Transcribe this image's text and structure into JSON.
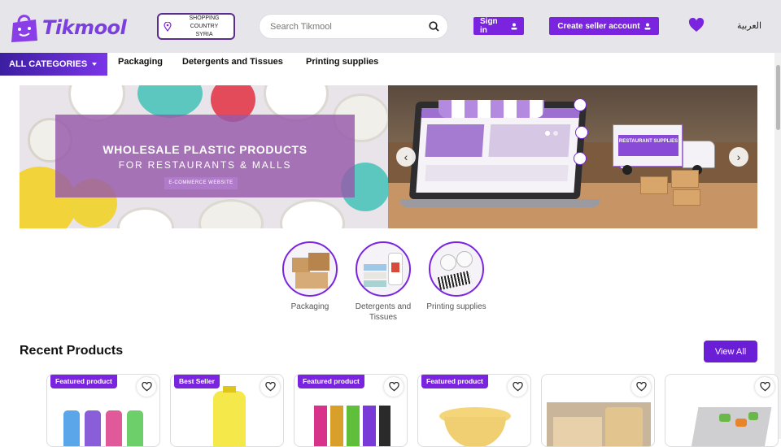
{
  "brand": {
    "name": "Tikmool",
    "accent": "#7a24e0"
  },
  "header": {
    "country_label": "SHOPPING COUNTRY",
    "country_value": "SYRIA",
    "search_placeholder": "Search Tikmool",
    "signin_label": "Sign in",
    "seller_label": "Create seller account",
    "language": "العربية",
    "icons": [
      "location-pin-icon",
      "search-icon",
      "user-icon",
      "heart-icon"
    ]
  },
  "nav": {
    "all_categories": "ALL CATEGORIES",
    "links": [
      "Packaging",
      "Detergents and Tissues",
      "Printing supplies"
    ]
  },
  "banner": {
    "title": "WHOLESALE PLASTIC PRODUCTS",
    "subtitle": "FOR RESTAURANTS & MALLS",
    "tag": "E-COMMERCE WEBSITE",
    "truck_text": "RESTAURANT SUPPLIES",
    "prev_icon": "‹",
    "next_icon": "›"
  },
  "categories": [
    {
      "label": "Packaging"
    },
    {
      "label": "Detergents and Tissues"
    },
    {
      "label": "Printing supplies"
    }
  ],
  "recent": {
    "title": "Recent Products",
    "view_all": "View All",
    "cards": [
      {
        "badge": "Featured product"
      },
      {
        "badge": "Best Seller"
      },
      {
        "badge": "Featured product"
      },
      {
        "badge": "Featured product"
      },
      {
        "badge": ""
      },
      {
        "badge": ""
      }
    ]
  }
}
